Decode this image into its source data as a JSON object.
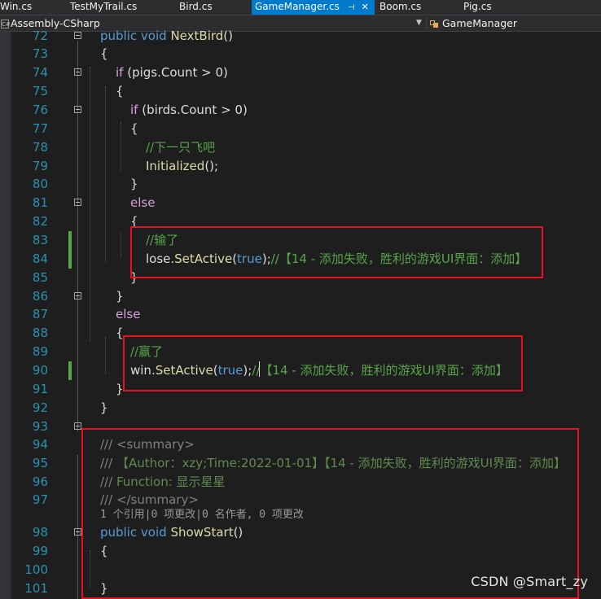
{
  "tabs": [
    {
      "label": "Win.cs",
      "active": false
    },
    {
      "label": "TestMyTrail.cs",
      "active": false
    },
    {
      "label": "Bird.cs",
      "active": false
    },
    {
      "label": "GameManager.cs",
      "active": true
    },
    {
      "label": "Boom.cs",
      "active": false
    },
    {
      "label": "Pig.cs",
      "active": false
    }
  ],
  "navbar": {
    "project": "Assembly-CSharp",
    "class": "GameManager"
  },
  "codeLens": "1 个引用|0 项更改|0 名作者, 0 项更改",
  "lines": [
    {
      "n": "72",
      "tokens": [
        {
          "t": "public",
          "c": "kw"
        },
        {
          "t": " "
        },
        {
          "t": "void",
          "c": "kw"
        },
        {
          "t": " "
        },
        {
          "t": "NextBird",
          "c": "mt"
        },
        {
          "t": "()"
        }
      ]
    },
    {
      "n": "73",
      "tokens": [
        {
          "t": "{"
        }
      ]
    },
    {
      "n": "74",
      "tokens": [
        {
          "t": "if",
          "c": "ctl"
        },
        {
          "t": " (pigs.Count > 0)"
        }
      ]
    },
    {
      "n": "75",
      "tokens": [
        {
          "t": "{"
        }
      ]
    },
    {
      "n": "76",
      "tokens": [
        {
          "t": "if",
          "c": "ctl"
        },
        {
          "t": " (birds.Count > 0)"
        }
      ]
    },
    {
      "n": "77",
      "tokens": [
        {
          "t": "{"
        }
      ]
    },
    {
      "n": "78",
      "tokens": [
        {
          "t": "//下一只飞吧",
          "c": "cm"
        }
      ]
    },
    {
      "n": "79",
      "tokens": [
        {
          "t": "Initialized",
          "c": "mt"
        },
        {
          "t": "();"
        }
      ]
    },
    {
      "n": "80",
      "tokens": [
        {
          "t": "}"
        }
      ]
    },
    {
      "n": "81",
      "tokens": [
        {
          "t": "else",
          "c": "ctl"
        }
      ]
    },
    {
      "n": "82",
      "tokens": [
        {
          "t": "{"
        }
      ]
    },
    {
      "n": "83",
      "tokens": [
        {
          "t": "//输了",
          "c": "cm"
        }
      ]
    },
    {
      "n": "84",
      "tokens": [
        {
          "t": "lose."
        },
        {
          "t": "SetActive",
          "c": "mt"
        },
        {
          "t": "("
        },
        {
          "t": "true",
          "c": "kw"
        },
        {
          "t": ");"
        },
        {
          "t": "//【14 - 添加失败，胜利的游戏UI界面：添加】",
          "c": "cm"
        }
      ]
    },
    {
      "n": "85",
      "tokens": [
        {
          "t": "}"
        }
      ]
    },
    {
      "n": "86",
      "tokens": [
        {
          "t": "}"
        }
      ]
    },
    {
      "n": "87",
      "tokens": [
        {
          "t": "else",
          "c": "ctl"
        }
      ]
    },
    {
      "n": "88",
      "tokens": [
        {
          "t": "{"
        }
      ]
    },
    {
      "n": "89",
      "tokens": [
        {
          "t": "//赢了",
          "c": "cm"
        }
      ]
    },
    {
      "n": "90",
      "tokens": [
        {
          "t": "win."
        },
        {
          "t": "SetActive",
          "c": "mt"
        },
        {
          "t": "("
        },
        {
          "t": "true",
          "c": "kw"
        },
        {
          "t": ");"
        },
        {
          "t": "//【14 - 添加失败，胜利的游戏UI界面：添加】",
          "c": "cm"
        }
      ]
    },
    {
      "n": "91",
      "tokens": [
        {
          "t": "}"
        }
      ]
    },
    {
      "n": "92",
      "tokens": [
        {
          "t": "}"
        }
      ]
    },
    {
      "n": "93",
      "tokens": []
    },
    {
      "n": "94",
      "tokens": [
        {
          "t": "/// ",
          "c": "dtag"
        },
        {
          "t": "<summary>",
          "c": "dtag"
        }
      ]
    },
    {
      "n": "95",
      "tokens": [
        {
          "t": "/// ",
          "c": "dtag"
        },
        {
          "t": "【Author：xzy;Time:2022-01-01】【14 - 添加失败，胜利的游戏UI界面：添加】",
          "c": "doc"
        }
      ]
    },
    {
      "n": "96",
      "tokens": [
        {
          "t": "/// ",
          "c": "dtag"
        },
        {
          "t": "Function: 显示星星",
          "c": "doc"
        }
      ]
    },
    {
      "n": "97",
      "tokens": [
        {
          "t": "/// ",
          "c": "dtag"
        },
        {
          "t": "</summary>",
          "c": "dtag"
        }
      ]
    },
    {
      "n": "98",
      "tokens": [
        {
          "t": "public",
          "c": "kw"
        },
        {
          "t": " "
        },
        {
          "t": "void",
          "c": "kw"
        },
        {
          "t": " "
        },
        {
          "t": "ShowStart",
          "c": "mt"
        },
        {
          "t": "()"
        }
      ]
    },
    {
      "n": "99",
      "tokens": [
        {
          "t": "{"
        }
      ]
    },
    {
      "n": "100",
      "tokens": []
    },
    {
      "n": "101",
      "tokens": [
        {
          "t": "}"
        }
      ]
    }
  ],
  "watermark": "CSDN @Smart_zy"
}
